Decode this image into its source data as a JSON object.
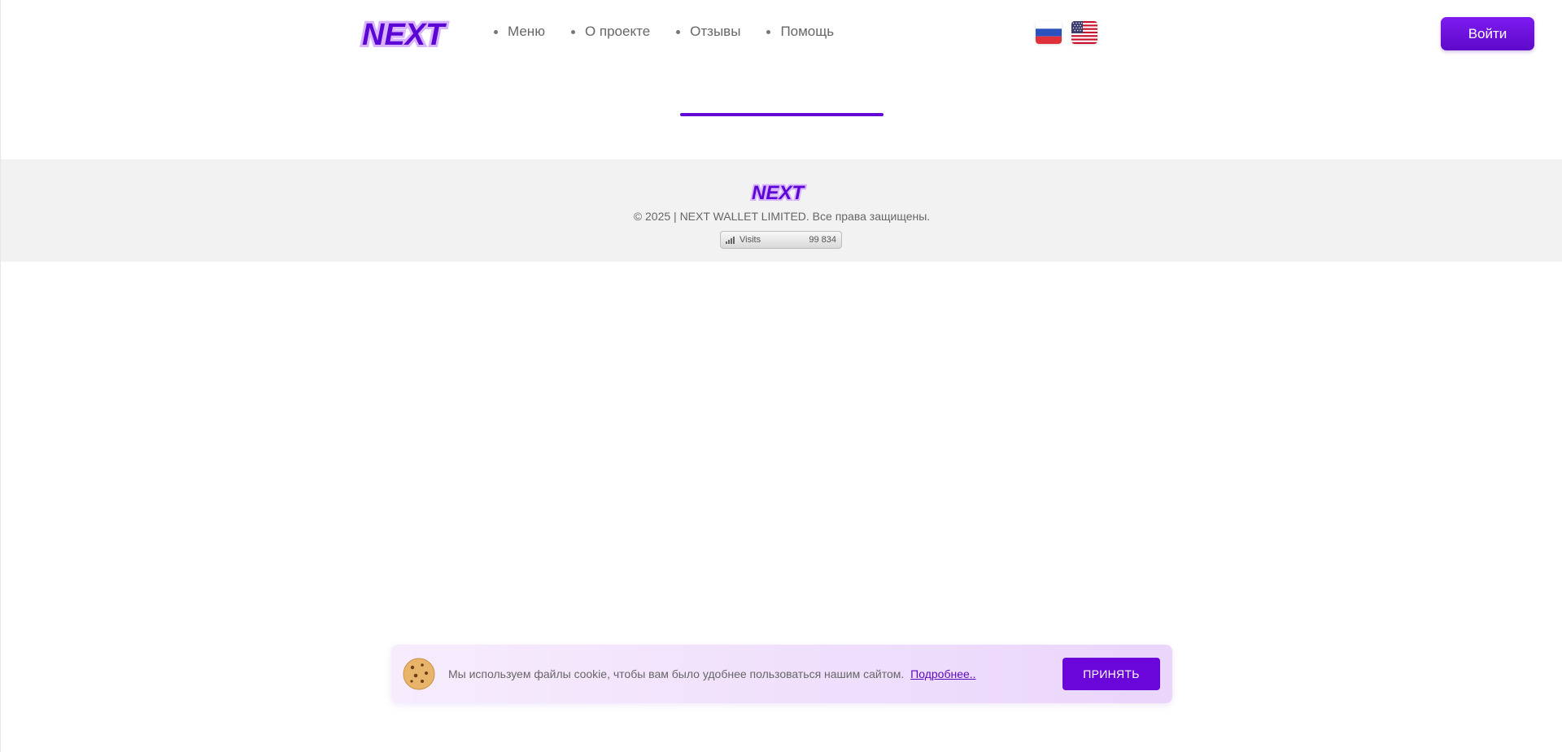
{
  "header": {
    "logo_text": "NEXT",
    "nav": [
      {
        "label": "Меню"
      },
      {
        "label": "О проекте"
      },
      {
        "label": "Отзывы"
      },
      {
        "label": "Помощь"
      }
    ],
    "languages": [
      "flag-ru-icon",
      "flag-us-icon"
    ],
    "login_label": "Войти"
  },
  "colors": {
    "accent": "#6408d6",
    "footer_bg": "#f2f2f2",
    "cookie_bg": "#f0e0fc"
  },
  "footer": {
    "logo_text": "NEXT",
    "copyright": "© 2025 | NEXT WALLET LIMITED. Все права защищены.",
    "counter_label": "Visits",
    "counter_value": "99 834"
  },
  "cookie": {
    "icon": "cookie-icon",
    "text": "Мы используем файлы cookie, чтобы вам было удобнее пользоваться нашим сайтом.",
    "link_label": "Подробнее..",
    "accept_label": "ПРИНЯТЬ"
  }
}
